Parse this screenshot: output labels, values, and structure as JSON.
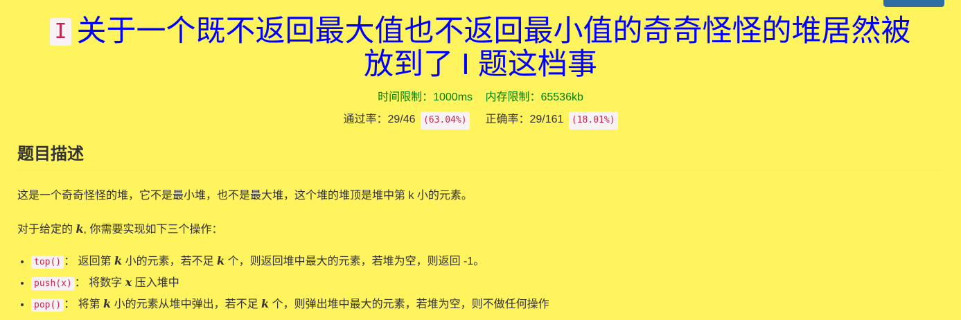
{
  "problem": {
    "id": "I",
    "title_line1": "关于一个既不返回最大值也不返回最小值的奇奇怪怪的堆居然被",
    "title_line2": "放到了 I 题这档事",
    "time_limit": "时间限制：1000ms",
    "memory_limit": "内存限制：65536kb",
    "pass_rate_label": "通过率：29/46",
    "pass_rate_pct": "(63.04%)",
    "accuracy_label": "正确率：29/161",
    "accuracy_pct": "(18.01%)"
  },
  "description": {
    "heading": "题目描述",
    "para1": "这是一个奇奇怪怪的堆，它不是最小堆，也不是最大堆，这个堆的堆顶是堆中第 k 小的元素。",
    "para2_prefix": "对于给定的 ",
    "para2_var": "k",
    "para2_suffix": ", 你需要实现如下三个操作："
  },
  "operations": [
    {
      "code": "top()",
      "text_a": "： 返回第 ",
      "var1": "k",
      "text_b": " 小的元素，若不足 ",
      "var2": "k",
      "text_c": " 个，则返回堆中最大的元素，若堆为空，则返回 -1。"
    },
    {
      "code": "push(x)",
      "text_a": "： 将数字 ",
      "var1": "x",
      "text_b": " 压入堆中"
    },
    {
      "code": "pop()",
      "text_a": "： 将第 ",
      "var1": "k",
      "text_b": " 小的元素从堆中弹出，若不足 ",
      "var2": "k",
      "text_c": " 个，则弹出堆中最大的元素，若堆为空，则不做任何操作"
    }
  ],
  "colors": {
    "background": "#fff35e",
    "title": "#0000ff",
    "limits": "#008000",
    "code_text": "#c7254e",
    "code_bg": "#f9f2f4",
    "top_button": "#2e6da4"
  }
}
